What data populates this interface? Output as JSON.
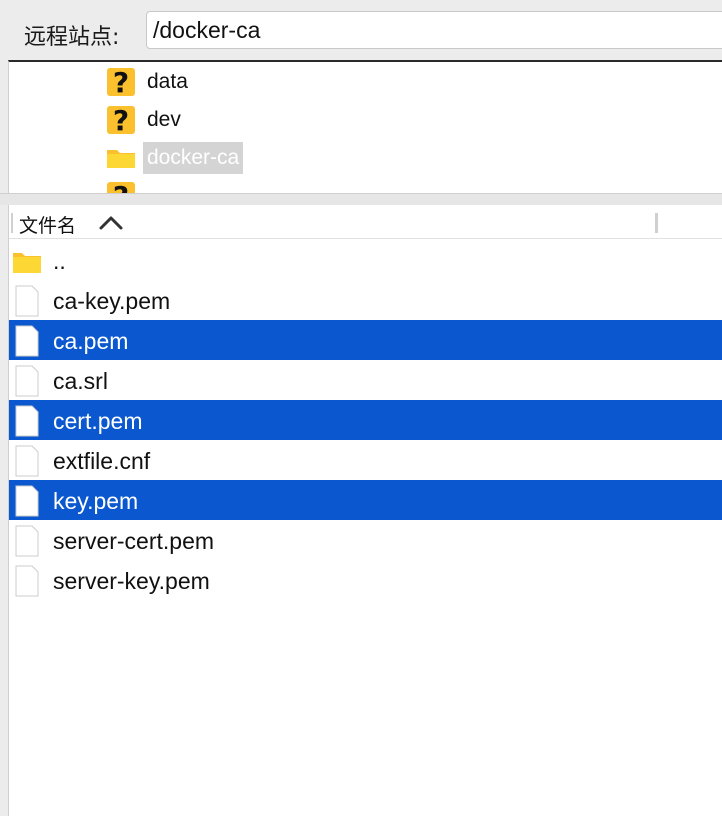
{
  "header": {
    "label": "远程站点:",
    "path_value": "/docker-ca"
  },
  "tree": {
    "items": [
      {
        "label": "data",
        "icon": "unknown-folder-icon",
        "selected": false
      },
      {
        "label": "dev",
        "icon": "unknown-folder-icon",
        "selected": false
      },
      {
        "label": "docker-ca",
        "icon": "folder-icon",
        "selected": true
      }
    ]
  },
  "file_list": {
    "column_header": "文件名",
    "sort_icon": "chevron-up-icon",
    "rows": [
      {
        "name": "..",
        "icon": "folder-icon",
        "selected": false
      },
      {
        "name": "ca-key.pem",
        "icon": "file-icon",
        "selected": false
      },
      {
        "name": "ca.pem",
        "icon": "file-icon",
        "selected": true
      },
      {
        "name": "ca.srl",
        "icon": "file-icon",
        "selected": false
      },
      {
        "name": "cert.pem",
        "icon": "file-icon",
        "selected": true
      },
      {
        "name": "extfile.cnf",
        "icon": "file-icon",
        "selected": false
      },
      {
        "name": "key.pem",
        "icon": "file-icon",
        "selected": true
      },
      {
        "name": "server-cert.pem",
        "icon": "file-icon",
        "selected": false
      },
      {
        "name": "server-key.pem",
        "icon": "file-icon",
        "selected": false
      }
    ]
  },
  "colors": {
    "selection": "#0a57d0",
    "folder": "#fbc02d"
  }
}
